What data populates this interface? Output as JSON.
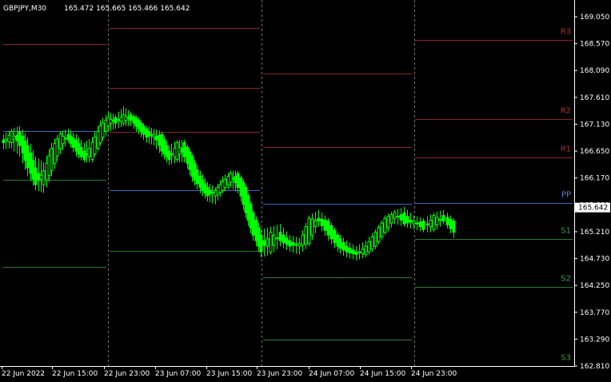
{
  "header": {
    "symbol": "GBPJPY,M30",
    "ohlc": "165.472 165.665 165.466 165.642"
  },
  "chart_data": {
    "type": "candlestick",
    "symbol": "GBPJPY",
    "timeframe": "M30",
    "current_price": "165.642",
    "ylim": [
      162.81,
      169.35
    ],
    "y_ticks": [
      "169.050",
      "168.570",
      "168.090",
      "167.610",
      "167.130",
      "166.650",
      "166.170",
      "165.690",
      "165.210",
      "164.730",
      "164.250",
      "163.770",
      "163.290",
      "162.810"
    ],
    "x_ticks": [
      "22 Jun 2022",
      "22 Jun 15:00",
      "22 Jun 23:00",
      "23 Jun 07:00",
      "23 Jun 15:00",
      "23 Jun 23:00",
      "24 Jun 07:00",
      "24 Jun 15:00",
      "24 Jun 23:00"
    ],
    "grid": false,
    "colors": {
      "background": "#000000",
      "candle": "#00ff00",
      "pivot": "#3a6ac0",
      "resistance": "#8b2323",
      "support": "#2f7a2f",
      "separator": "#6f6f6f",
      "axis_text": "#ffffff",
      "resistance_label": "#b03030",
      "support_label": "#3f9a3f",
      "pivot_label": "#5a82d0"
    },
    "pivot_labels": [
      "R3",
      "R2",
      "R1",
      "PP",
      "S1",
      "S2",
      "S3"
    ],
    "sessions": [
      {
        "R3": 168.57,
        "R2": null,
        "R1": null,
        "PP": 167.01,
        "S1": 166.14,
        "S2": 164.58,
        "S3": null
      },
      {
        "R3": 168.85,
        "R2": 167.78,
        "R1": 167.0,
        "PP": 165.95,
        "S1": 164.87,
        "S2": null,
        "S3": null
      },
      {
        "R3": 168.04,
        "R2": 166.72,
        "R1": 165.71,
        "PP": 165.71,
        "S1": 164.39,
        "S2": 163.28,
        "S3": null
      },
      {
        "R3": 168.63,
        "R2": 167.22,
        "R1": 166.53,
        "PP": 165.72,
        "S1": 165.08,
        "S2": 164.23,
        "S3": 162.81
      }
    ],
    "candle_path": [
      [
        166.85,
        166.95,
        166.68,
        166.8
      ],
      [
        166.8,
        167.05,
        166.7,
        167.0
      ],
      [
        167.0,
        167.1,
        166.55,
        166.75
      ],
      [
        166.75,
        166.9,
        166.2,
        166.35
      ],
      [
        166.35,
        166.55,
        165.95,
        166.05
      ],
      [
        166.05,
        166.45,
        165.9,
        166.3
      ],
      [
        166.3,
        166.8,
        166.2,
        166.7
      ],
      [
        166.7,
        167.0,
        166.6,
        166.95
      ],
      [
        166.95,
        167.05,
        166.8,
        166.85
      ],
      [
        166.85,
        166.95,
        166.55,
        166.65
      ],
      [
        166.65,
        166.8,
        166.45,
        166.5
      ],
      [
        166.5,
        166.9,
        166.45,
        166.8
      ],
      [
        166.8,
        167.2,
        166.75,
        167.1
      ],
      [
        167.1,
        167.35,
        167.0,
        167.25
      ],
      [
        167.25,
        167.3,
        167.05,
        167.15
      ],
      [
        167.15,
        167.45,
        167.1,
        167.3
      ],
      [
        167.3,
        167.35,
        167.1,
        167.2
      ],
      [
        167.2,
        167.25,
        166.95,
        167.05
      ],
      [
        167.05,
        167.1,
        166.8,
        166.9
      ],
      [
        166.9,
        167.05,
        166.75,
        166.95
      ],
      [
        166.95,
        167.0,
        166.55,
        166.65
      ],
      [
        166.65,
        166.75,
        166.4,
        166.5
      ],
      [
        166.5,
        166.85,
        166.45,
        166.8
      ],
      [
        166.8,
        166.85,
        166.45,
        166.55
      ],
      [
        166.55,
        166.6,
        166.1,
        166.2
      ],
      [
        166.2,
        166.3,
        165.9,
        166.0
      ],
      [
        166.0,
        166.1,
        165.75,
        165.85
      ],
      [
        165.85,
        166.0,
        165.7,
        165.95
      ],
      [
        165.95,
        166.2,
        165.9,
        166.1
      ],
      [
        166.1,
        166.3,
        166.0,
        166.25
      ],
      [
        166.25,
        166.3,
        165.9,
        166.0
      ],
      [
        166.0,
        166.05,
        165.45,
        165.55
      ],
      [
        165.55,
        165.6,
        165.05,
        165.15
      ],
      [
        165.15,
        165.25,
        164.75,
        164.85
      ],
      [
        164.85,
        165.3,
        164.8,
        165.2
      ],
      [
        165.2,
        165.35,
        164.95,
        165.05
      ],
      [
        165.05,
        165.15,
        164.85,
        164.95
      ],
      [
        164.95,
        165.1,
        164.8,
        165.0
      ],
      [
        165.0,
        165.5,
        164.95,
        165.45
      ],
      [
        165.45,
        165.6,
        165.3,
        165.4
      ],
      [
        165.4,
        165.45,
        165.05,
        165.15
      ],
      [
        165.15,
        165.2,
        164.85,
        164.95
      ],
      [
        164.95,
        165.05,
        164.75,
        164.85
      ],
      [
        164.85,
        164.95,
        164.7,
        164.8
      ],
      [
        164.8,
        165.05,
        164.75,
        164.95
      ],
      [
        164.95,
        165.25,
        164.9,
        165.2
      ],
      [
        165.2,
        165.5,
        165.15,
        165.45
      ],
      [
        165.45,
        165.6,
        165.35,
        165.55
      ],
      [
        165.55,
        165.65,
        165.3,
        165.35
      ],
      [
        165.35,
        165.5,
        165.25,
        165.4
      ],
      [
        165.4,
        165.45,
        165.2,
        165.25
      ],
      [
        165.25,
        165.55,
        165.2,
        165.5
      ],
      [
        165.5,
        165.6,
        165.35,
        165.4
      ],
      [
        165.4,
        165.45,
        165.1,
        165.2
      ],
      [
        165.2,
        165.4,
        165.1,
        165.35
      ],
      [
        165.35,
        165.5,
        165.2,
        165.25
      ],
      [
        165.25,
        165.4,
        165.15,
        165.35
      ],
      [
        165.35,
        165.45,
        165.05,
        165.1
      ],
      [
        165.1,
        165.2,
        164.8,
        164.9
      ],
      [
        164.9,
        165.3,
        164.85,
        165.25
      ],
      [
        165.25,
        165.75,
        165.2,
        165.7
      ],
      [
        165.7,
        166.05,
        165.65,
        165.95
      ],
      [
        165.95,
        166.25,
        165.9,
        166.15
      ],
      [
        166.15,
        166.2,
        165.85,
        165.95
      ],
      [
        165.95,
        166.05,
        165.8,
        166.0
      ],
      [
        166.0,
        166.25,
        165.95,
        166.15
      ],
      [
        166.15,
        166.2,
        165.85,
        165.9
      ],
      [
        165.9,
        166.05,
        165.8,
        166.0
      ],
      [
        166.0,
        166.1,
        165.85,
        165.95
      ],
      [
        165.95,
        166.05,
        165.75,
        165.85
      ],
      [
        165.85,
        166.0,
        165.75,
        165.95
      ],
      [
        165.95,
        166.1,
        165.85,
        166.05
      ],
      [
        166.05,
        166.15,
        165.85,
        165.9
      ],
      [
        165.9,
        166.05,
        165.8,
        166.0
      ],
      [
        166.0,
        166.2,
        165.9,
        166.1
      ],
      [
        166.1,
        166.15,
        165.8,
        165.85
      ],
      [
        165.85,
        165.9,
        165.15,
        165.25
      ],
      [
        165.25,
        165.45,
        165.1,
        165.35
      ],
      [
        165.35,
        165.5,
        165.15,
        165.25
      ],
      [
        165.25,
        165.55,
        165.2,
        165.45
      ],
      [
        165.47,
        165.67,
        165.47,
        165.64
      ]
    ]
  }
}
